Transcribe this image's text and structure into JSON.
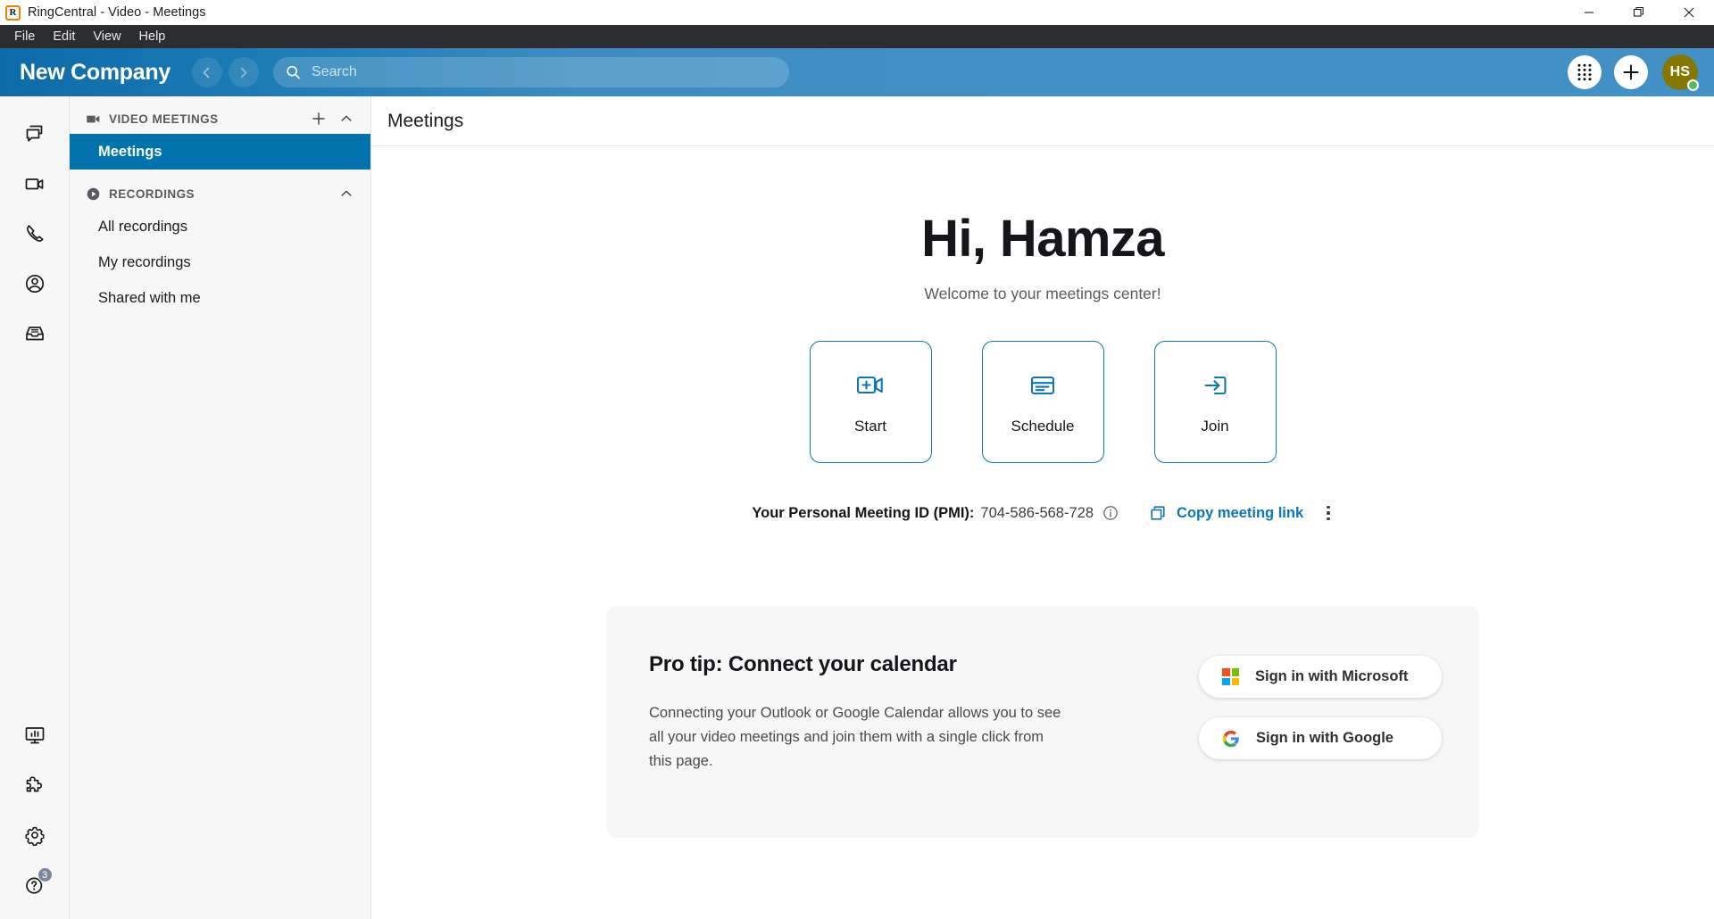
{
  "window": {
    "title": "RingCentral - Video - Meetings",
    "logo_letter": "R",
    "controls": {
      "minimize": "minimize-icon",
      "restore": "restore-icon",
      "close": "close-icon"
    }
  },
  "menubar": {
    "items": [
      "File",
      "Edit",
      "View",
      "Help"
    ]
  },
  "header": {
    "brand": "New Company",
    "back_icon": "chevron-left-icon",
    "forward_icon": "chevron-right-icon",
    "search": {
      "placeholder": "Search",
      "value": "",
      "icon": "search-icon"
    },
    "dialpad_icon": "dialpad-icon",
    "plus_icon": "plus-icon",
    "avatar": {
      "initials": "HS",
      "color": "#857700",
      "presence": "available",
      "presence_color": "#5cb85c"
    },
    "gradient_from": "#0d6ba8",
    "gradient_to": "#4291c6"
  },
  "rail": {
    "top_items": [
      {
        "name": "message",
        "icon": "message-bubbles-icon"
      },
      {
        "name": "video",
        "icon": "video-camera-icon"
      },
      {
        "name": "phone",
        "icon": "phone-handset-icon"
      },
      {
        "name": "contacts",
        "icon": "person-circle-icon"
      },
      {
        "name": "fax",
        "icon": "inbox-tray-icon"
      }
    ],
    "bottom_items": [
      {
        "name": "analytics",
        "icon": "monitor-chart-icon"
      },
      {
        "name": "apps",
        "icon": "puzzle-piece-icon"
      },
      {
        "name": "settings",
        "icon": "gear-icon"
      },
      {
        "name": "help",
        "icon": "question-circle-icon",
        "badge": "3"
      }
    ]
  },
  "sidebar": {
    "sections": [
      {
        "title": "VIDEO MEETINGS",
        "icon": "video-camera-icon",
        "add_icon": "plus-icon",
        "collapse_icon": "chevron-up-icon",
        "items": [
          {
            "label": "Meetings",
            "active": true
          }
        ]
      },
      {
        "title": "RECORDINGS",
        "icon": "play-circle-icon",
        "collapse_icon": "chevron-up-icon",
        "items": [
          {
            "label": "All recordings",
            "active": false
          },
          {
            "label": "My recordings",
            "active": false
          },
          {
            "label": "Shared with me",
            "active": false
          }
        ]
      }
    ]
  },
  "main": {
    "page_title": "Meetings",
    "greeting": "Hi, Hamza",
    "welcome": "Welcome to your meetings center!",
    "cards": [
      {
        "label": "Start",
        "icon": "video-plus-icon"
      },
      {
        "label": "Schedule",
        "icon": "calendar-card-icon"
      },
      {
        "label": "Join",
        "icon": "arrow-enter-icon"
      }
    ],
    "pmi": {
      "label": "Your Personal Meeting ID (PMI):",
      "value": "704-586-568-728",
      "info_icon": "info-icon",
      "copy_label": "Copy meeting link",
      "copy_icon": "copy-icon",
      "more_icon": "more-vertical-icon"
    },
    "protip": {
      "title": "Pro tip: Connect your calendar",
      "body": "Connecting your Outlook or Google Calendar allows you to see all your video meetings and join them with a single click from this page.",
      "buttons": [
        {
          "label": "Sign in with Microsoft",
          "icon": "microsoft-logo-icon"
        },
        {
          "label": "Sign in with Google",
          "icon": "google-logo-icon"
        }
      ]
    }
  },
  "colors": {
    "accent_blue": "#0f76b5",
    "active_nav": "#0073ad",
    "panel_gray": "#f7f7f8"
  }
}
